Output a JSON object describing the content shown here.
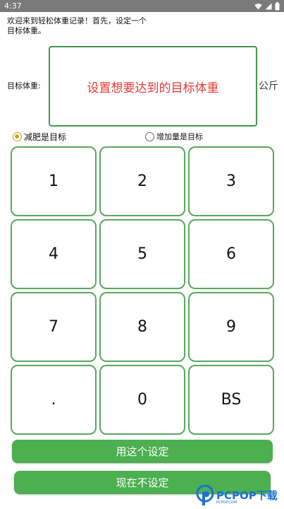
{
  "status_bar": {
    "time": "4:37",
    "icons": [
      "wifi-icon",
      "signal-icon",
      "battery-icon"
    ]
  },
  "intro": {
    "text": "欢迎来到轻松体重记录！首先，设定一个目标体重。"
  },
  "target_weight": {
    "label": "目标体重:",
    "placeholder": "设置想要达到的目标体重",
    "unit": "公斤",
    "placeholder_color": "#e53935"
  },
  "goal_options": [
    {
      "label": "减肥是目标",
      "selected": true
    },
    {
      "label": "增加量是目标",
      "selected": false
    }
  ],
  "keypad": {
    "keys": [
      "1",
      "2",
      "3",
      "4",
      "5",
      "6",
      "7",
      "8",
      "9",
      ".",
      "0",
      "BS"
    ]
  },
  "actions": {
    "use_setting": "用这个设定",
    "skip_setting": "现在不设定"
  },
  "watermark": {
    "text": "PCPOP下载",
    "subtext": "PCPOP.COM"
  },
  "colors": {
    "accent_green": "#4caf50",
    "border_green": "#5aa75f",
    "radio_selected": "#d4a31a",
    "watermark_blue": "#1c6fd8"
  }
}
